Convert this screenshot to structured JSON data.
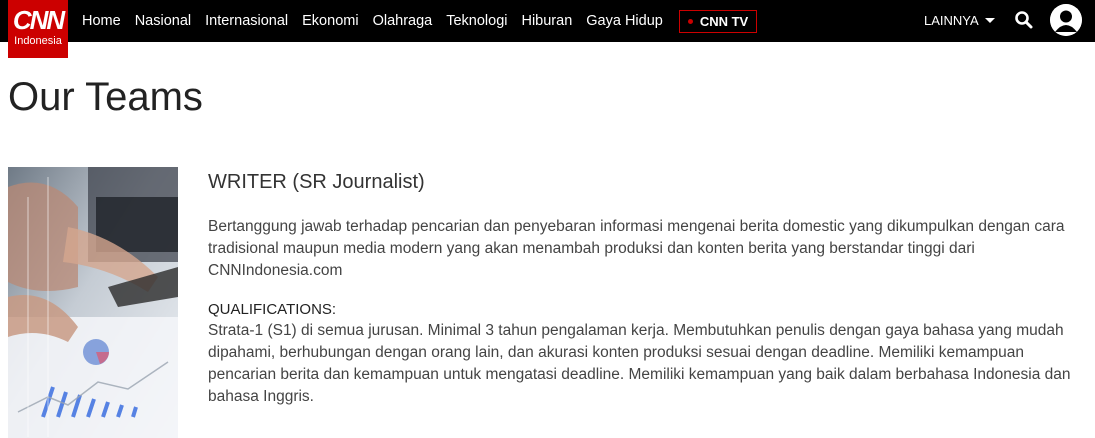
{
  "header": {
    "logo_main": "CNN",
    "logo_sub": "Indonesia",
    "nav": [
      "Home",
      "Nasional",
      "Internasional",
      "Ekonomi",
      "Olahraga",
      "Teknologi",
      "Hiburan",
      "Gaya Hidup"
    ],
    "tv_label": "CNN TV",
    "more_label": "LAINNYA"
  },
  "page": {
    "title": "Our Teams"
  },
  "team": {
    "role": "WRITER (SR Journalist)",
    "description": "Bertanggung jawab terhadap pencarian dan penyebaran informasi mengenai berita domestic yang dikumpulkan dengan cara tradisional maupun media modern yang akan menambah produksi dan konten berita yang berstandar tinggi dari CNNIndonesia.com",
    "qualifications_heading": "QUALIFICATIONS:",
    "qualifications": "Strata-1 (S1) di semua jurusan. Minimal 3 tahun pengalaman kerja. Membutuhkan penulis dengan gaya bahasa yang mudah dipahami, berhubungan dengan orang lain, dan akurasi konten produksi sesuai dengan deadline. Memiliki kemampuan pencarian berita dan kemampuan untuk mengatasi deadline. Memiliki kemampuan yang baik dalam berbahasa Indonesia dan bahasa Inggris."
  },
  "colors": {
    "brand_red": "#cc0000",
    "header_bg": "#000000"
  },
  "icons": {
    "search": "search-icon",
    "user": "user-icon",
    "caret": "caret-down-icon"
  }
}
